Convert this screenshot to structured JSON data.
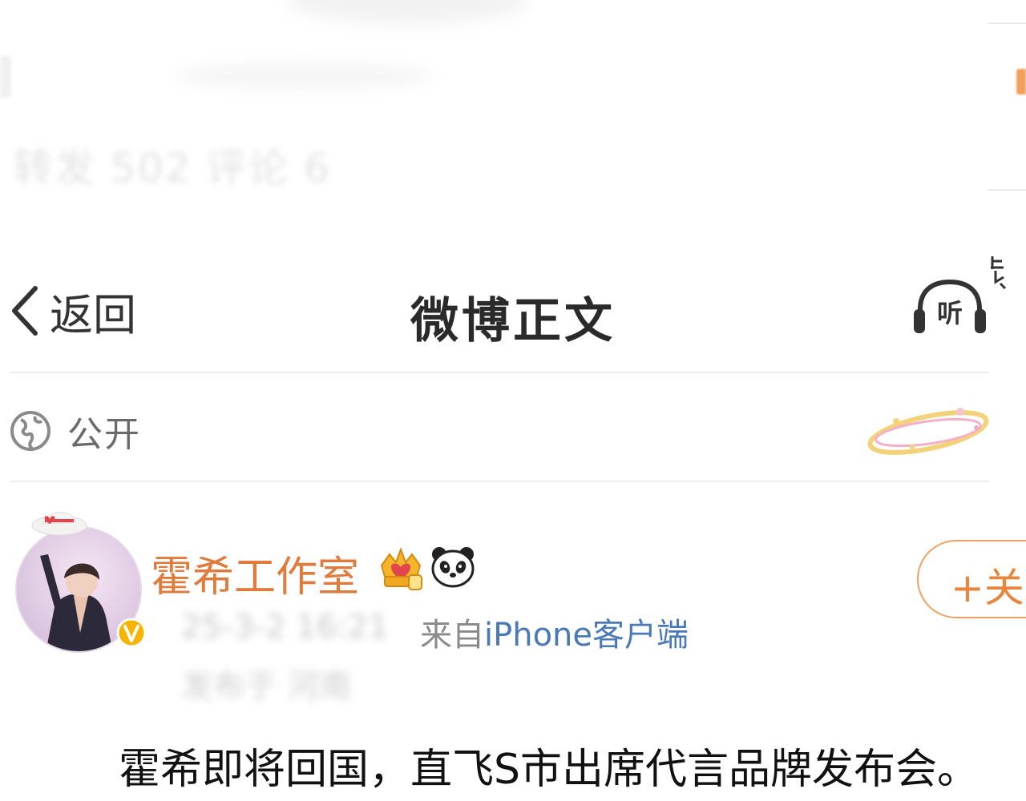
{
  "background": {
    "faded_text": "转发 502  评论 6"
  },
  "nav": {
    "back_label": "返回",
    "title": "微博正文",
    "listen_label": "听",
    "icons": {
      "back": "chevron-left-icon",
      "listen": "headphones-icon"
    }
  },
  "visibility": {
    "label": "公开",
    "icon": "globe-icon"
  },
  "author": {
    "name": "霍希工作室",
    "badges": [
      "crown-badge-icon",
      "panda-icon"
    ],
    "verified_icon": "verified-v-icon",
    "time": "25-3-2 16:21",
    "location": "发布于 河南",
    "source_prefix": "来自",
    "source_device": "iPhone客户端",
    "follow_label": "+关注"
  },
  "caption": "霍希即将回国，直飞S市出席代言品牌发布会。",
  "colors": {
    "author_name": "#e07b3e",
    "follow_border": "#f0a060",
    "source_link": "#4a79b8",
    "verified": "#f5b400"
  }
}
